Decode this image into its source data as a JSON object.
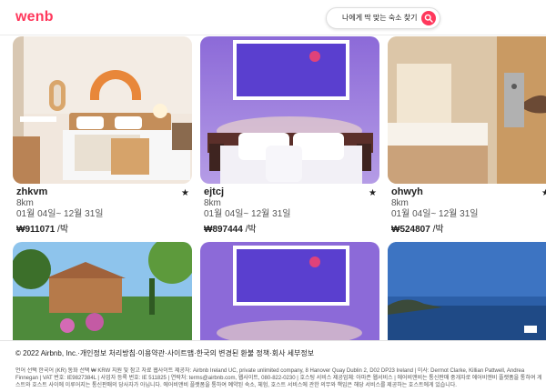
{
  "brand": {
    "logo": "wenb",
    "color": "#ff385c"
  },
  "search": {
    "label": "나에게 딱 맞는 숙소 찾기",
    "icon": "search-icon"
  },
  "listings": [
    {
      "name": "zhkvm",
      "distance": "8km",
      "dates": "01월 04일~ 12월 31일",
      "price": "₩911071",
      "unit": "/박",
      "icon": "star-icon"
    },
    {
      "name": "ejtcj",
      "distance": "8km",
      "dates": "01월 04일~ 12월 31일",
      "price": "₩897444",
      "unit": "/박",
      "icon": "star-icon"
    },
    {
      "name": "ohwyh",
      "distance": "8km",
      "dates": "01월 04일~ 12월 31일",
      "price": "₩524807",
      "unit": "/박",
      "icon": "star-icon"
    }
  ],
  "footer": {
    "links": "© 2022 Airbnb, Inc.·개인정보 처리방침·이용약관·사이트맵·한국의 변경된 환불 정책·회사 세부정보",
    "legal": "언어 선택 한국어 (KR) 통화 선택 ₩ KRW 지원 및 참고 자료 웹사이트 제공자: Airbnb Ireland UC, private unlimited company, 8 Hanover Quay Dublin 2, D02 DP23 Ireland | 이사: Dermot Clarke, Killian Pattwell, Andrea Finnegan | VAT 번호: IE9827384L | 사업자 등록 번호: IE 511825 | 연락처: terms@airbnb.com, 웹사이트, 080-822-0230 | 호스팅 서비스 제공업체: 아마존 웹서비스 | 에어비앤비는 통신판매 중개자로 에어비앤비 플랫폼을 통하여 게스트와 호스트 사이에 이루어지는 통신판매의 당사자가 아닙니다. 에어비앤비 플랫폼을 통하여 예약된 숙소, 체험, 호스트 서비스에 관한 의무와 책임은 해당 서비스를 제공하는 호스트에게 있습니다."
  }
}
